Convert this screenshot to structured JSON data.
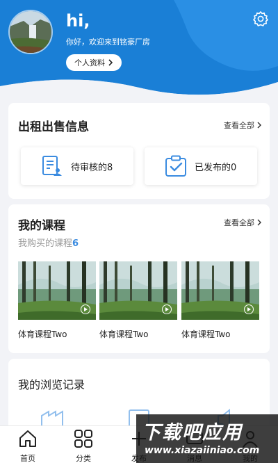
{
  "header": {
    "greeting": "hi,",
    "welcome": "你好，欢迎来到铭豪厂房",
    "profile_button": "个人资料",
    "settings_icon": "gear-icon",
    "brand_color": "#1a7fd6"
  },
  "rental": {
    "title": "出租出售信息",
    "view_all": "查看全部",
    "pending_label": "待审核的8",
    "published_label": "已发布的0"
  },
  "courses": {
    "title": "我的课程",
    "view_all": "查看全部",
    "purchased_label": "我购买的课程",
    "purchased_count": "6",
    "items": [
      {
        "name": "体育课程Two"
      },
      {
        "name": "体育课程Two"
      },
      {
        "name": "体育课程Two"
      }
    ]
  },
  "history": {
    "title": "我的浏览记录"
  },
  "tabbar": {
    "items": [
      {
        "label": "首页",
        "icon": "home-icon"
      },
      {
        "label": "分类",
        "icon": "grid-icon"
      },
      {
        "label": "发布",
        "icon": "plus-icon"
      },
      {
        "label": "消息",
        "icon": "message-icon"
      },
      {
        "label": "我的",
        "icon": "user-icon"
      }
    ]
  },
  "watermark": {
    "title": "下载吧应用",
    "url": "www.xiazaiiniao.com"
  }
}
